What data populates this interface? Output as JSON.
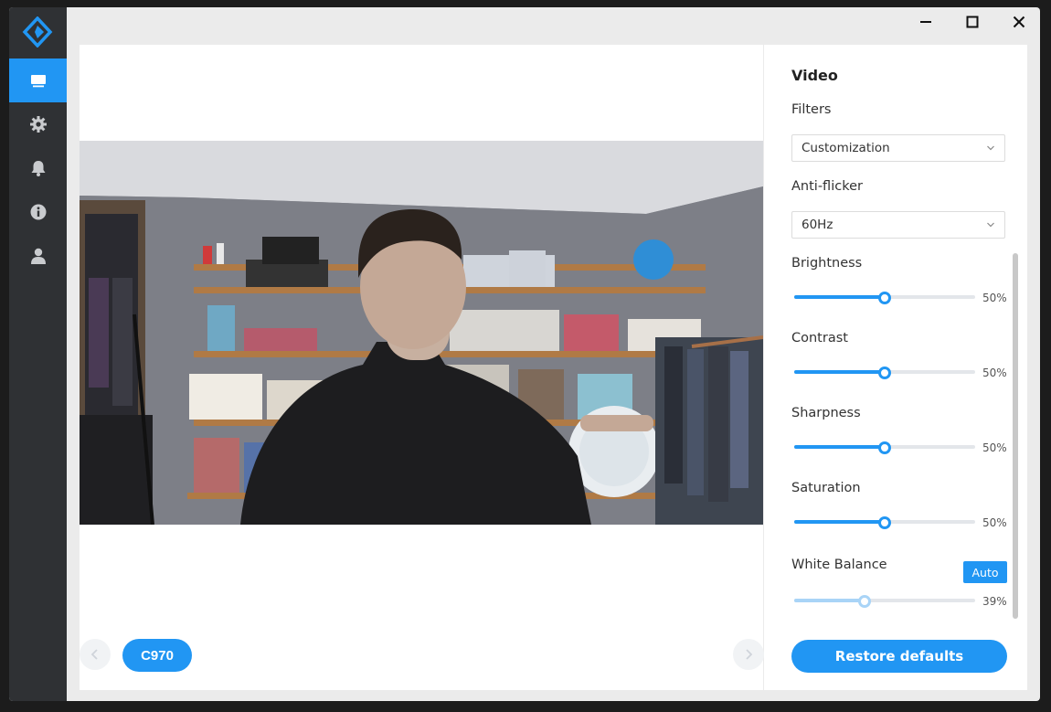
{
  "sidebar": {
    "logo_icon": "app-logo-icon",
    "items": [
      {
        "name": "monitor",
        "icon": "monitor-icon",
        "active": true
      },
      {
        "name": "settings",
        "icon": "gear-icon",
        "active": false
      },
      {
        "name": "notifications",
        "icon": "bell-icon",
        "active": false
      },
      {
        "name": "info",
        "icon": "info-icon",
        "active": false
      },
      {
        "name": "account",
        "icon": "user-icon",
        "active": false
      }
    ]
  },
  "window_controls": [
    "minimize-icon",
    "maximize-icon",
    "close-icon"
  ],
  "preview": {
    "camera_name": "C970",
    "prev_icon": "chevron-left-icon",
    "next_icon": "chevron-right-icon"
  },
  "settings": {
    "section_title": "Video",
    "filters": {
      "label": "Filters",
      "value": "Customization"
    },
    "anti_flicker": {
      "label": "Anti-flicker",
      "value": "60Hz"
    },
    "brightness": {
      "label": "Brightness",
      "value": 50,
      "display": "50%"
    },
    "contrast": {
      "label": "Contrast",
      "value": 50,
      "display": "50%"
    },
    "sharpness": {
      "label": "Sharpness",
      "value": 50,
      "display": "50%"
    },
    "saturation": {
      "label": "Saturation",
      "value": 50,
      "display": "50%"
    },
    "white_balance": {
      "label": "White Balance",
      "auto_label": "Auto",
      "value": 39,
      "display": "39%"
    },
    "restore_label": "Restore defaults"
  },
  "colors": {
    "accent": "#2196f3",
    "sidebar": "#2f3134"
  }
}
